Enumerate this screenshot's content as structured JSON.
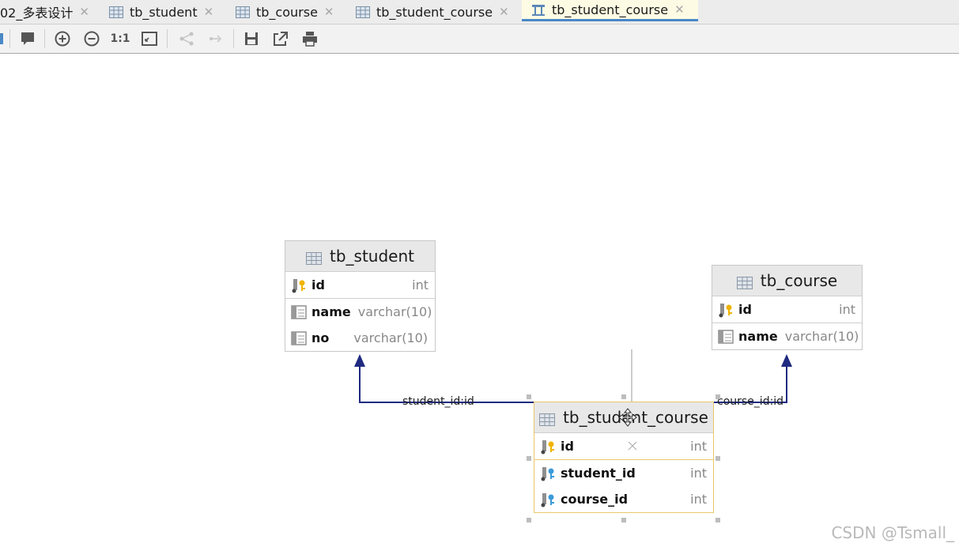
{
  "tabs": [
    {
      "label": "02_多表设计",
      "active": false
    },
    {
      "label": "tb_student",
      "active": false
    },
    {
      "label": "tb_course",
      "active": false
    },
    {
      "label": "tb_student_course",
      "active": false
    },
    {
      "label": "tb_student_course",
      "active": true
    }
  ],
  "toolbar": {
    "actual_size_label": "1:1",
    "icons": [
      "comment-icon",
      "zoom-in-icon",
      "zoom-out-icon",
      "actual-size-icon",
      "fit-content-icon",
      "layout-icon",
      "apply-layout-icon",
      "save-icon",
      "export-icon",
      "print-icon"
    ]
  },
  "entities": {
    "student": {
      "name": "tb_student",
      "columns": [
        {
          "name": "id",
          "type": "int"
        },
        {
          "name": "name",
          "type": "varchar(10)"
        },
        {
          "name": "no",
          "type": "varchar(10)"
        }
      ]
    },
    "course": {
      "name": "tb_course",
      "columns": [
        {
          "name": "id",
          "type": "int"
        },
        {
          "name": "name",
          "type": "varchar(10)"
        }
      ]
    },
    "student_course": {
      "name": "tb_student_course",
      "columns": [
        {
          "name": "id",
          "type": "int"
        },
        {
          "name": "student_id",
          "type": "int"
        },
        {
          "name": "course_id",
          "type": "int"
        }
      ]
    }
  },
  "relations": {
    "student_fk": "student_id:id",
    "course_fk": "course_id:id"
  },
  "colors": {
    "relation_line": "#1f2a80",
    "selection_border": "#e8c86a",
    "active_tab_underline": "#4a88c7"
  },
  "watermark": "CSDN @Tsmall_"
}
